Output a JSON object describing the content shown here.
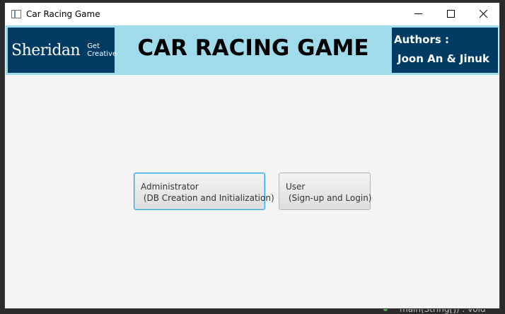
{
  "window": {
    "title": "Car Racing Game"
  },
  "banner": {
    "logo": {
      "wordmark": "Sheridan",
      "tagline": "Get\nCreative"
    },
    "title": "CAR RACING GAME",
    "authors": {
      "label": "Authors :",
      "names": "Joon An & Jinuk"
    }
  },
  "actions": {
    "admin_button": "Administrator\n (DB Creation and Initialization)",
    "user_button": "User\n (Sign-up and Login)"
  },
  "background_ide": {
    "method_text": "main(String[]) : void"
  },
  "colors": {
    "banner_bg": "#9fdbeb",
    "brand_navy": "#003b64",
    "focus_border": "#2aa3e0",
    "window_bg": "#f4f4f4"
  }
}
